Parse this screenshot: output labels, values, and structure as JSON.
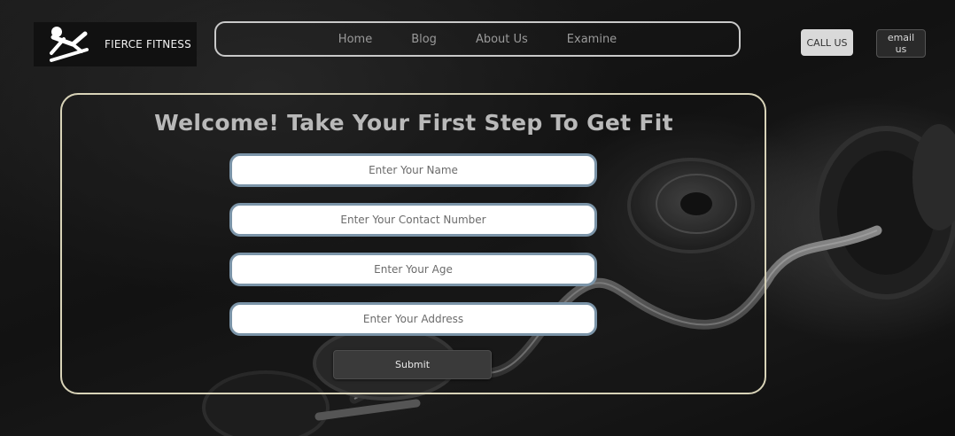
{
  "brand": {
    "name": "FIERCE FITNESS",
    "logo_icon": "situp-figure-icon"
  },
  "nav": {
    "items": [
      {
        "label": "Home"
      },
      {
        "label": "Blog"
      },
      {
        "label": "About Us"
      },
      {
        "label": "Examine"
      }
    ]
  },
  "header_buttons": {
    "call_label": "CALL US",
    "email_label": "email us"
  },
  "form": {
    "title": "Welcome! Take Your First Step To Get Fit",
    "name_placeholder": "Enter Your Name",
    "contact_placeholder": "Enter Your Contact Number",
    "age_placeholder": "Enter Your Age",
    "address_placeholder": "Enter Your Address",
    "submit_label": "Submit"
  },
  "colors": {
    "panel_border": "#d8d3b8",
    "nav_border": "#c9c9c9",
    "field_border": "#7b94a8"
  }
}
